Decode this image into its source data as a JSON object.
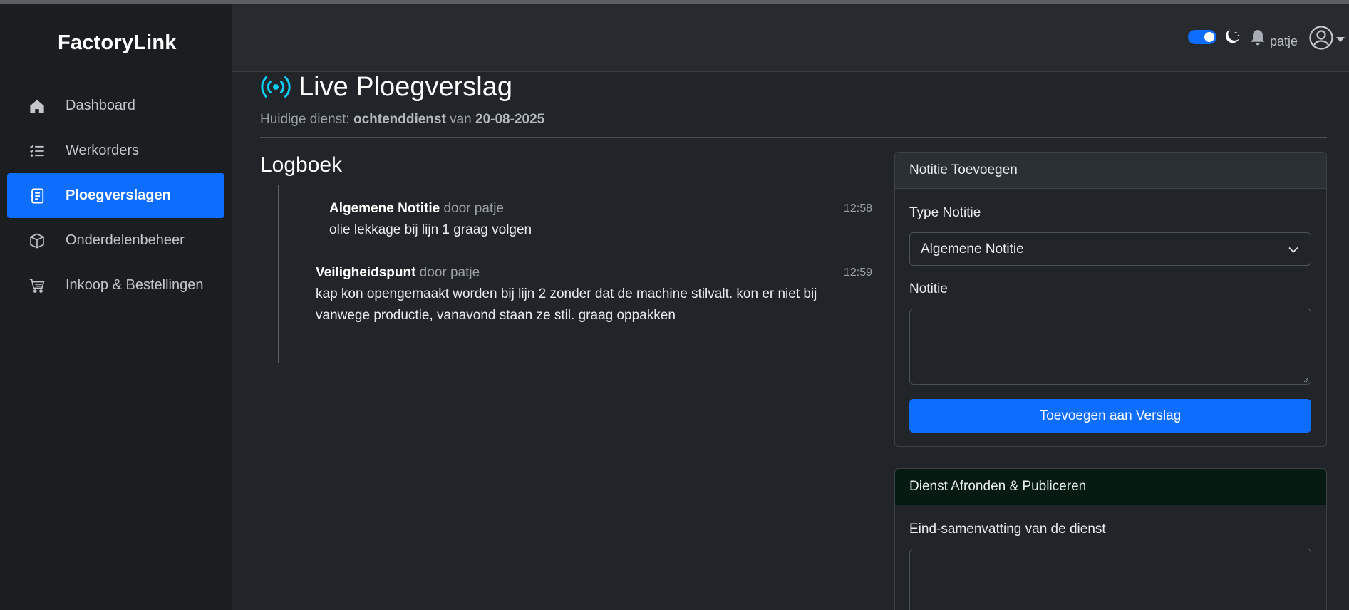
{
  "app": {
    "brand": "FactoryLink"
  },
  "sidebar": {
    "items": [
      {
        "label": "Dashboard",
        "icon": "home-icon"
      },
      {
        "label": "Werkorders",
        "icon": "list-icon"
      },
      {
        "label": "Ploegverslagen",
        "icon": "journal-icon",
        "active": true
      },
      {
        "label": "Onderdelenbeheer",
        "icon": "box-icon"
      },
      {
        "label": "Inkoop & Bestellingen",
        "icon": "cart-icon"
      }
    ]
  },
  "topbar": {
    "username": "patje",
    "dark_mode_toggle": "on"
  },
  "page": {
    "title": "Live Ploegverslag",
    "subtitle_prefix": "Huidige dienst: ",
    "shift": "ochtenddienst",
    "subtitle_mid": " van ",
    "date": "20-08-2025"
  },
  "logboek": {
    "title": "Logboek",
    "entries": [
      {
        "type": "Algemene Notitie",
        "by": " door patje",
        "text": "olie lekkage bij lijn 1 graag volgen",
        "time": "12:58"
      },
      {
        "type": "Veiligheidspunt",
        "by": " door patje",
        "text_line1": "kap kon opengemaakt worden bij lijn 2 zonder dat de machine stilvalt. kon er niet bij",
        "text_line2": "vanwege productie, vanavond staan ze stil. graag oppakken",
        "time": "12:59"
      }
    ]
  },
  "note_card": {
    "header": "Notitie Toevoegen",
    "type_label": "Type Notitie",
    "type_value": "Algemene Notitie",
    "note_label": "Notitie",
    "submit": "Toevoegen aan Verslag"
  },
  "finish_card": {
    "header": "Dienst Afronden & Publiceren",
    "summary_label": "Eind-samenvatting van de dienst"
  },
  "colors": {
    "accent": "#0d6efd",
    "broadcast": "#0dcaf0"
  }
}
